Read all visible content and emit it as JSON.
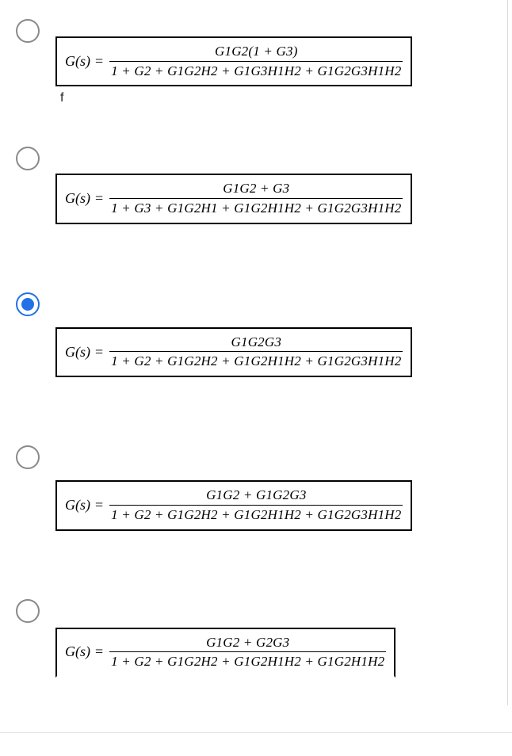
{
  "question": {
    "lhs": "G(s)",
    "equals": "=",
    "options": [
      {
        "id": "opt-a",
        "selected": false,
        "numerator": "G1G2(1 + G3)",
        "denominator": "1 + G2 + G1G2H2 + G1G3H1H2 + G1G2G3H1H2",
        "caption": "f"
      },
      {
        "id": "opt-b",
        "selected": false,
        "numerator": "G1G2 + G3",
        "denominator": "1 + G3 + G1G2H1 + G1G2H1H2 + G1G2G3H1H2",
        "caption": ""
      },
      {
        "id": "opt-c",
        "selected": true,
        "numerator": "G1G2G3",
        "denominator": "1 + G2 + G1G2H2 + G1G2H1H2 + G1G2G3H1H2",
        "caption": ""
      },
      {
        "id": "opt-d",
        "selected": false,
        "numerator": "G1G2 + G1G2G3",
        "denominator": "1 + G2 + G1G2H2 + G1G2H1H2 + G1G2G3H1H2",
        "caption": ""
      },
      {
        "id": "opt-e",
        "selected": false,
        "numerator": "G1G2 + G2G3",
        "denominator": "1 + G2 + G1G2H2 + G1G2H1H2 + G1G2H1H2",
        "caption": ""
      }
    ]
  }
}
